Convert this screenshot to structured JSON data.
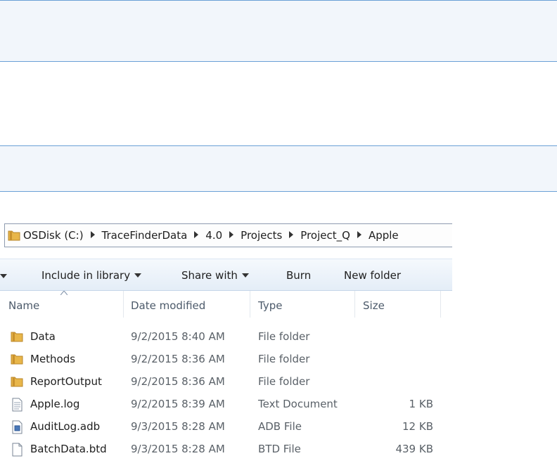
{
  "address_bar": {
    "path": [
      "OSDisk (C:)",
      "TraceFinderData",
      "4.0",
      "Projects",
      "Project_Q",
      "Apple"
    ]
  },
  "toolbar": {
    "include_label": "Include in library",
    "share_label": "Share with",
    "burn_label": "Burn",
    "new_folder_label": "New folder"
  },
  "columns": {
    "name": "Name",
    "date": "Date modified",
    "type": "Type",
    "size": "Size"
  },
  "files": [
    {
      "name": "Data",
      "date": "9/2/2015 8:40 AM",
      "type": "File folder",
      "size": "",
      "icon": "folder-icon"
    },
    {
      "name": "Methods",
      "date": "9/2/2015 8:36 AM",
      "type": "File folder",
      "size": "",
      "icon": "folder-icon"
    },
    {
      "name": "ReportOutput",
      "date": "9/2/2015 8:36 AM",
      "type": "File folder",
      "size": "",
      "icon": "folder-icon"
    },
    {
      "name": "Apple.log",
      "date": "9/2/2015 8:39 AM",
      "type": "Text Document",
      "size": "1 KB",
      "icon": "text-file-icon"
    },
    {
      "name": "AuditLog.adb",
      "date": "9/3/2015 8:28 AM",
      "type": "ADB File",
      "size": "12 KB",
      "icon": "adb-file-icon"
    },
    {
      "name": "BatchData.btd",
      "date": "9/3/2015 8:28 AM",
      "type": "BTD File",
      "size": "439 KB",
      "icon": "blank-file-icon"
    }
  ],
  "colors": {
    "band_border": "#6aa0d6",
    "folder_yellow": "#e8b64a"
  }
}
